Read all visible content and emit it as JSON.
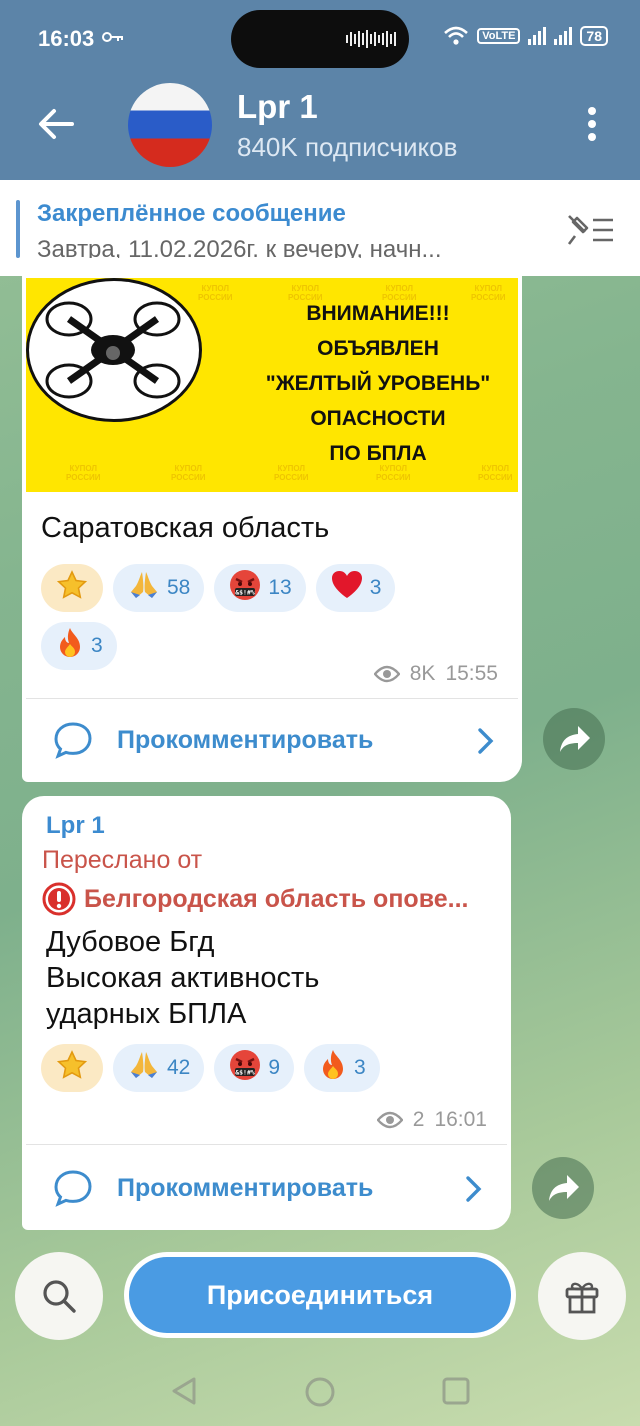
{
  "status_bar": {
    "time": "16:03",
    "volte": "VoLTE",
    "battery": "78"
  },
  "header": {
    "channel_name": "Lpr 1",
    "subscribers": "840K подписчиков"
  },
  "pinned": {
    "title": "Закреплённое сообщение",
    "text": "Завтра, 11.02.2026г. к вечеру, начн..."
  },
  "messages": [
    {
      "banner": {
        "lines": [
          "ВНИМАНИЕ!!!",
          "ОБЪЯВЛЕН",
          "\"ЖЕЛТЫЙ УРОВЕНЬ\"",
          "ОПАСНОСТИ",
          "ПО БПЛА"
        ],
        "watermark": "КУПОЛ РОССИИ"
      },
      "text": "Саратовская область",
      "reactions": [
        {
          "icon": "star-icon",
          "count": ""
        },
        {
          "icon": "pray-icon",
          "count": "58"
        },
        {
          "icon": "angry-icon",
          "count": "13"
        },
        {
          "icon": "heart-icon",
          "count": "3"
        },
        {
          "icon": "fire-icon",
          "count": "3"
        }
      ],
      "views": "8K",
      "time": "15:55",
      "comment_label": "Прокомментировать"
    },
    {
      "sender": "Lpr 1",
      "forwarded_label": "Переслано от",
      "forwarded_source": "Белгородская область опове...",
      "text_lines": [
        "Дубовое Бгд",
        "Высокая активность",
        "ударных БПЛА"
      ],
      "reactions": [
        {
          "icon": "star-icon",
          "count": ""
        },
        {
          "icon": "pray-icon",
          "count": "42"
        },
        {
          "icon": "angry-icon",
          "count": "9"
        },
        {
          "icon": "fire-icon",
          "count": "3"
        }
      ],
      "views": "2",
      "time": "16:01",
      "comment_label": "Прокомментировать"
    }
  ],
  "bottom_bar": {
    "join_label": "Присоединиться"
  },
  "colors": {
    "header": "#5c84a8",
    "accent": "#3d8ccd",
    "join": "#4a9be3",
    "forwarded": "#c9544a"
  }
}
